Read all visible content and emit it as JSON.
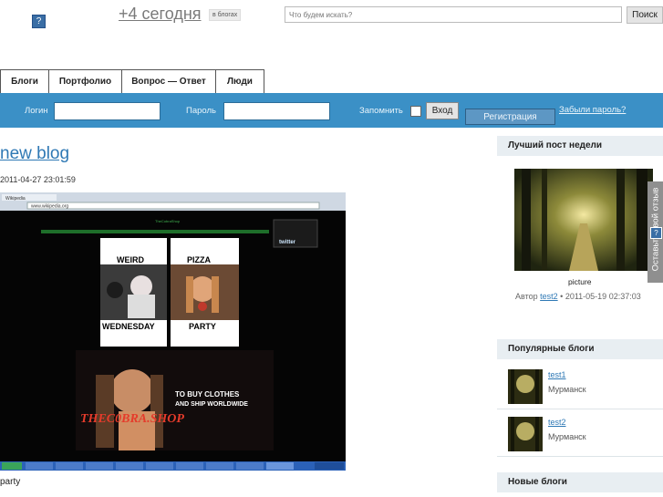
{
  "header": {
    "help_icon": "?",
    "today_link": "+4 сегодня",
    "blogs_badge": "в блогах",
    "search_placeholder": "Что будем искать?",
    "search_button": "Поиск"
  },
  "nav": {
    "tabs": [
      {
        "label": "Блоги"
      },
      {
        "label": "Портфолио"
      },
      {
        "label": "Вопрос — Ответ"
      },
      {
        "label": "Люди"
      }
    ]
  },
  "login_bar": {
    "login_label": "Логин",
    "password_label": "Пароль",
    "remember_label": "Запомнить",
    "enter_button": "Вход",
    "register_button": "Регистрация",
    "forgot_link": "Забыли пароль?",
    "bar_color": "#3b90c6"
  },
  "post": {
    "title": "new blog",
    "date": "2011-04-27 23:01:59",
    "caption": "party",
    "image_texts": {
      "wikipedia_title": "Wikipedia",
      "address": "www.wikipedia.org",
      "banner": "THEC0BRA.SHOP",
      "weird": "WEIRD",
      "pizza": "PIZZA",
      "wednesday": "WEDNESDAY",
      "party": "PARTY",
      "buy": "TO BUY CLOTHES",
      "ship": "AND SHIP WORLDWIDE",
      "twitter": "twitter"
    }
  },
  "sidebar": {
    "best_post": {
      "heading": "Лучший пост недели",
      "caption": "picture",
      "author_prefix": "Автор",
      "author": "test2",
      "date_suffix": "• 2011-05-19 02:37:03"
    },
    "popular": {
      "heading": "Популярные блоги",
      "items": [
        {
          "name": "test1",
          "city": "Мурманск"
        },
        {
          "name": "test2",
          "city": "Мурманск"
        }
      ]
    },
    "new_blogs": {
      "heading": "Новые блоги"
    }
  },
  "feedback": {
    "label": "Оставьте свой отзыв",
    "icon": "?"
  }
}
